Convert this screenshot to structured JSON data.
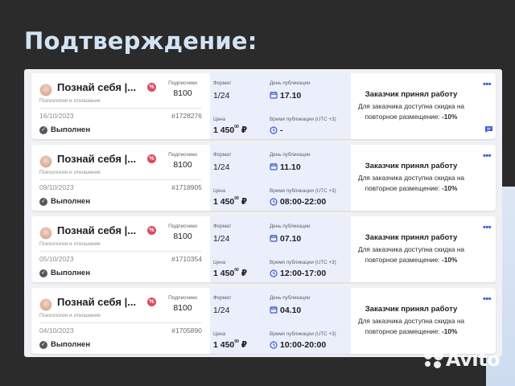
{
  "heading": "Подтверждение:",
  "watermark": "Avito",
  "colors": {
    "accent": "#3c5bd6",
    "badge": "#e0475a",
    "mid_bg": "#eaeffb"
  },
  "orders": [
    {
      "channel_name": "Познай себя |...",
      "category": "Психология и отношения",
      "badge": "%",
      "subscribers_label": "Подписчики",
      "subscribers": "8100",
      "date": "16/10/2023",
      "order_id": "#1728276",
      "status": "Выполнен",
      "format_label": "Формат",
      "format": "1/24",
      "pub_day_label": "День публикации",
      "pub_day": "17.10",
      "price_label": "Цена",
      "price": "1 450",
      "price_cents": "00",
      "currency": "₽",
      "pub_time_label": "Время публикации (UTC +3)",
      "pub_time": "-",
      "confirm_title": "Заказчик принял работу",
      "confirm_line1": "Для заказчика доступна скидка на",
      "confirm_line2": "повторное размещение: ",
      "discount": "-10%",
      "has_chat": true
    },
    {
      "channel_name": "Познай себя |...",
      "category": "Психология и отношения",
      "badge": "%",
      "subscribers_label": "Подписчики",
      "subscribers": "8100",
      "date": "09/10/2023",
      "order_id": "#1718905",
      "status": "Выполнен",
      "format_label": "Формат",
      "format": "1/24",
      "pub_day_label": "День публикации",
      "pub_day": "11.10",
      "price_label": "Цена",
      "price": "1 450",
      "price_cents": "00",
      "currency": "₽",
      "pub_time_label": "Время публикации (UTC +3)",
      "pub_time": "08:00-22:00",
      "confirm_title": "Заказчик принял работу",
      "confirm_line1": "Для заказчика доступна скидка на",
      "confirm_line2": "повторное размещение: ",
      "discount": "-10%",
      "has_chat": false
    },
    {
      "channel_name": "Познай себя |...",
      "category": "Психология и отношения",
      "badge": "%",
      "subscribers_label": "Подписчики",
      "subscribers": "8100",
      "date": "05/10/2023",
      "order_id": "#1710354",
      "status": "Выполнен",
      "format_label": "Формат",
      "format": "1/24",
      "pub_day_label": "День публикации",
      "pub_day": "07.10",
      "price_label": "Цена",
      "price": "1 450",
      "price_cents": "00",
      "currency": "₽",
      "pub_time_label": "Время публикации (UTC +3)",
      "pub_time": "12:00-17:00",
      "confirm_title": "Заказчик принял работу",
      "confirm_line1": "Для заказчика доступна скидка на",
      "confirm_line2": "повторное размещение: ",
      "discount": "-10%",
      "has_chat": false
    },
    {
      "channel_name": "Познай себя |...",
      "category": "Психология и отношения",
      "badge": "%",
      "subscribers_label": "Подписчики",
      "subscribers": "8100",
      "date": "04/10/2023",
      "order_id": "#1705890",
      "status": "Выполнен",
      "format_label": "Формат",
      "format": "1/24",
      "pub_day_label": "День публикации",
      "pub_day": "04.10",
      "price_label": "Цена",
      "price": "1 450",
      "price_cents": "00",
      "currency": "₽",
      "pub_time_label": "Время публикации (UTC +3)",
      "pub_time": "10:00-20:00",
      "confirm_title": "Заказчик принял работу",
      "confirm_line1": "Для заказчика доступна скидка на",
      "confirm_line2": "повторное размещение: ",
      "discount": "-10%",
      "has_chat": false
    }
  ]
}
